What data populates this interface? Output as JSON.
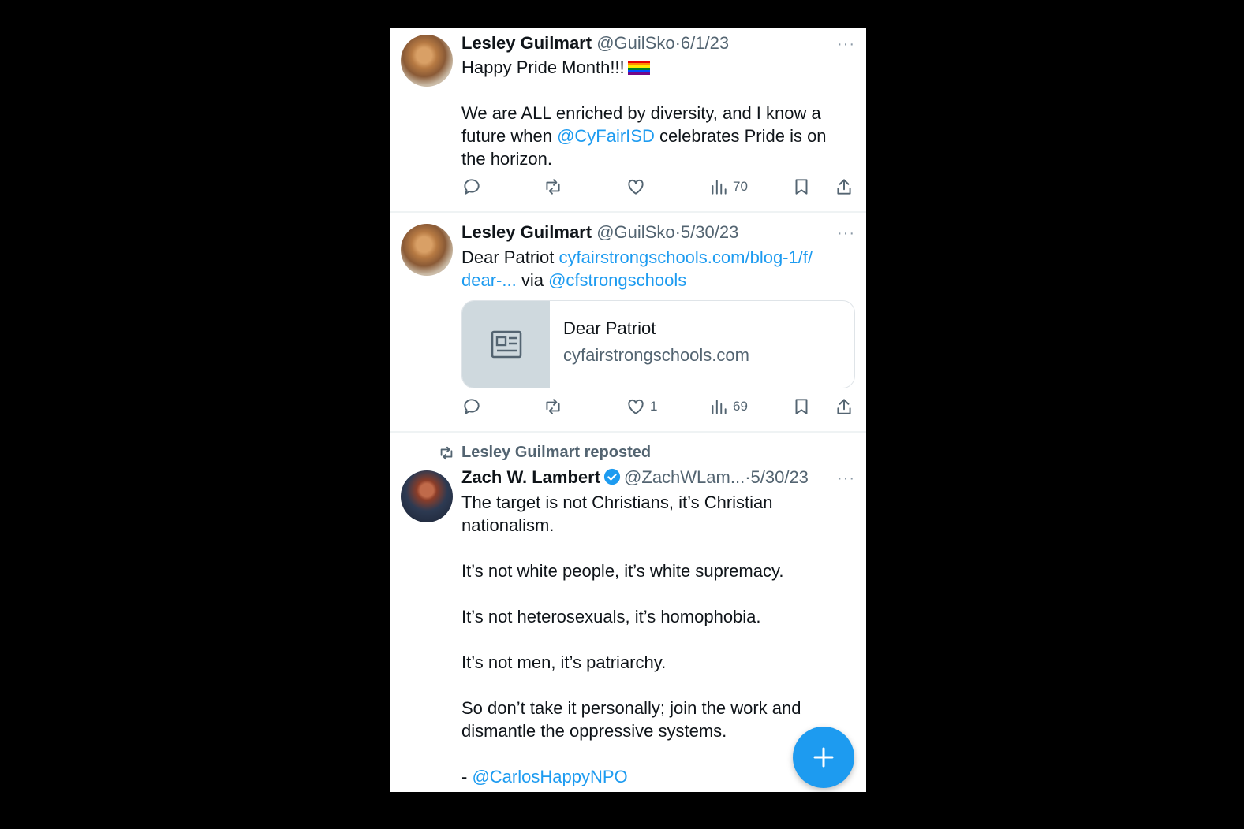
{
  "tweets": [
    {
      "name": "Lesley Guilmart",
      "handle": "@GuilSko",
      "sep": "·",
      "date": "6/1/23",
      "line1": "Happy Pride Month!!!",
      "flag_icon": "rainbow-flag-icon",
      "text_a": "We are ALL enriched by diversity, and I know a\nfuture when ",
      "mention": "@CyFairISD",
      "text_b": " celebrates Pride is on\nthe horizon.",
      "views": "70"
    },
    {
      "name": "Lesley Guilmart",
      "handle": "@GuilSko",
      "sep": "·",
      "date": "5/30/23",
      "text_a": "Dear Patriot ",
      "link": "cyfairstrongschools.com/blog-1/f/\ndear-...",
      "text_b": " via ",
      "mention": "@cfstrongschools",
      "card_title": "Dear Patriot",
      "card_domain": "cyfairstrongschools.com",
      "likes": "1",
      "views": "69"
    }
  ],
  "repost": {
    "label": "Lesley Guilmart reposted",
    "name": "Zach W. Lambert",
    "handle": "@ZachWLam...",
    "sep": "·",
    "date": "5/30/23",
    "text": "The target is not Christians, it’s Christian\nnationalism.\n\nIt’s not white people, it’s white supremacy.\n\nIt’s not heterosexuals, it’s homophobia.\n\nIt’s not men, it’s patriarchy.\n\nSo don’t take it personally; join the work and\ndismantle the oppressive systems.\n\n- ",
    "mention": "@CarlosHappyNPO"
  },
  "more_label": "···",
  "colors": {
    "accent": "#1d9bf0",
    "muted": "#536471"
  }
}
